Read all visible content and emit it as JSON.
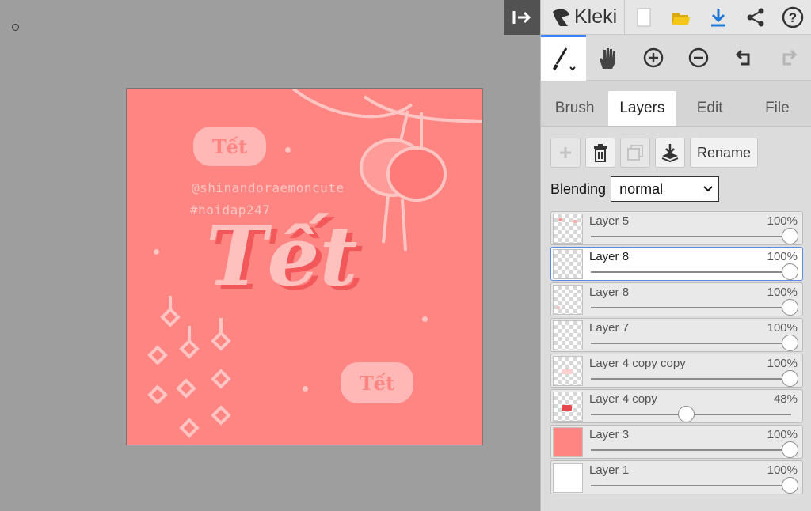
{
  "app": {
    "name": "Kleki"
  },
  "canvas": {
    "small_labels": [
      "Tết",
      "Tết"
    ],
    "handle": "@shinandoraemoncute",
    "hashtag": "#hoidap247",
    "big_word": "Tết"
  },
  "tabs": [
    {
      "label": "Brush",
      "active": false
    },
    {
      "label": "Layers",
      "active": true
    },
    {
      "label": "Edit",
      "active": false
    },
    {
      "label": "File",
      "active": false
    }
  ],
  "layers_panel": {
    "rename_label": "Rename",
    "blending_label": "Blending",
    "blending_value": "normal",
    "layers": [
      {
        "name": "Layer 5",
        "opacity_text": "100%",
        "opacity": 1.0,
        "selected": false,
        "thumb": "checker-marks"
      },
      {
        "name": "Layer 8",
        "opacity_text": "100%",
        "opacity": 1.0,
        "selected": true,
        "thumb": "checker"
      },
      {
        "name": "Layer 8",
        "opacity_text": "100%",
        "opacity": 1.0,
        "selected": false,
        "thumb": "checker-dot"
      },
      {
        "name": "Layer 7",
        "opacity_text": "100%",
        "opacity": 1.0,
        "selected": false,
        "thumb": "checker"
      },
      {
        "name": "Layer 4 copy copy",
        "opacity_text": "100%",
        "opacity": 1.0,
        "selected": false,
        "thumb": "checker-faint"
      },
      {
        "name": "Layer 4 copy",
        "opacity_text": "48%",
        "opacity": 0.48,
        "selected": false,
        "thumb": "checker-red"
      },
      {
        "name": "Layer 3",
        "opacity_text": "100%",
        "opacity": 1.0,
        "selected": false,
        "thumb": "solid-pink"
      },
      {
        "name": "Layer 1",
        "opacity_text": "100%",
        "opacity": 1.0,
        "selected": false,
        "thumb": "solid-white"
      }
    ]
  },
  "colors": {
    "canvas_bg": "#ff8583",
    "accent": "#3b82f6",
    "download": "#1e78d6",
    "folder": "#f5c518"
  }
}
